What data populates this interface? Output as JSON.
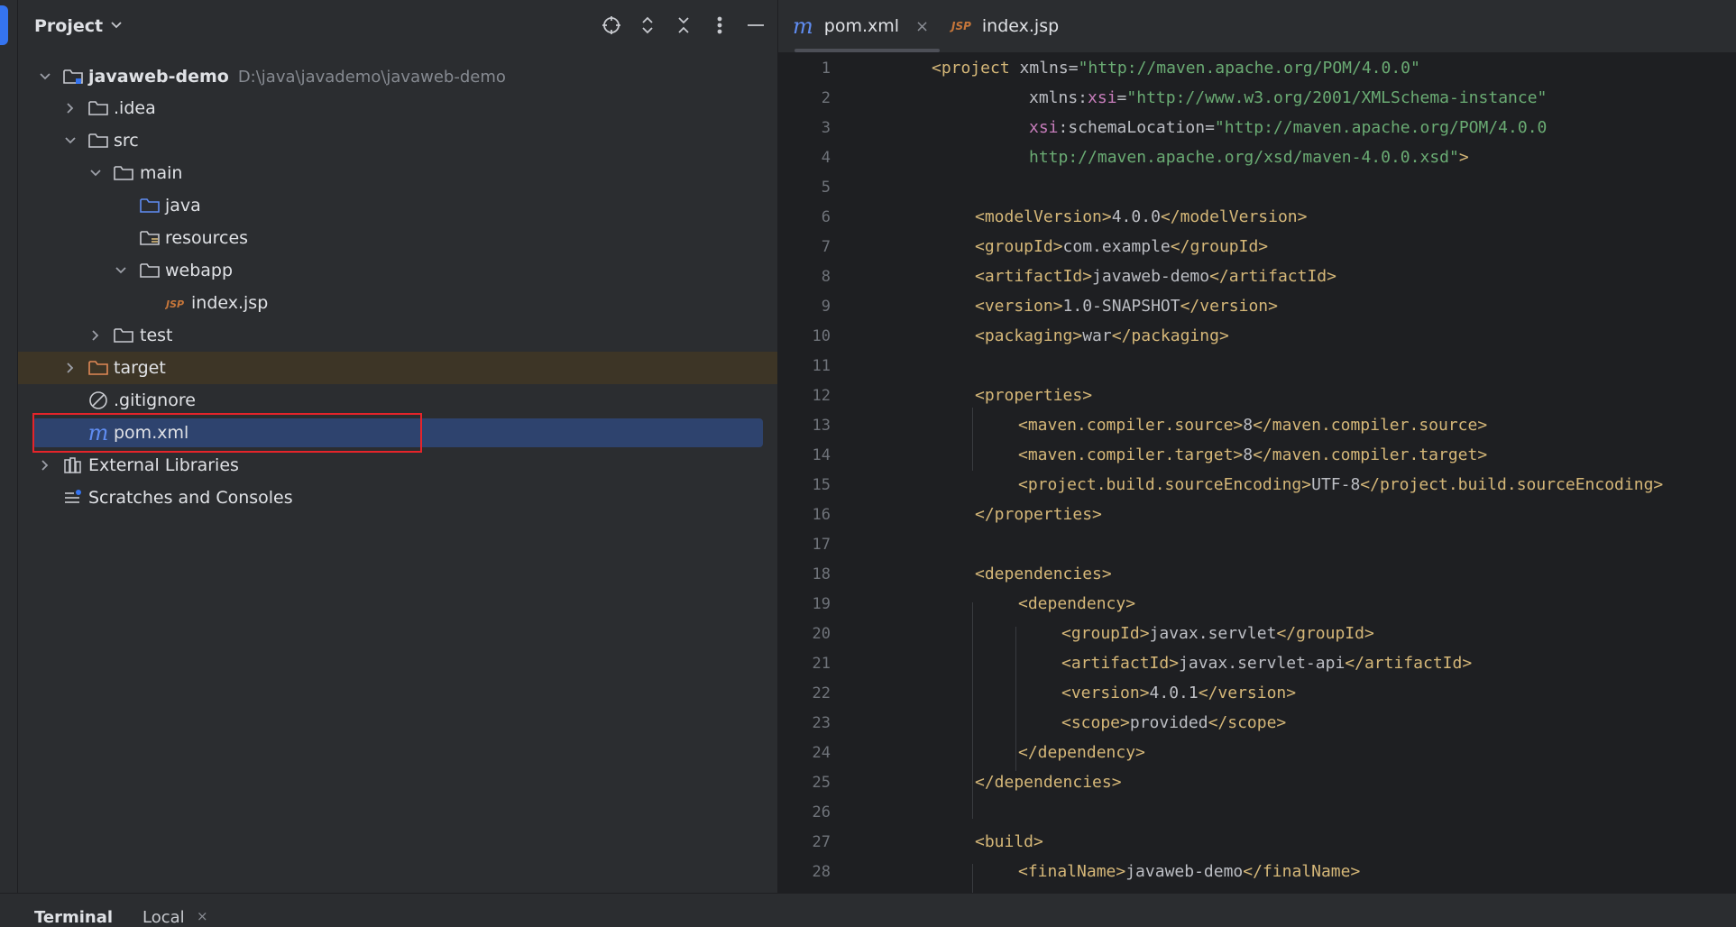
{
  "project_panel": {
    "title": "Project",
    "tree": [
      {
        "label": "javaweb-demo",
        "path": "D:\\java\\javademo\\javaweb-demo",
        "icon": "module-folder-icon",
        "state": "expanded"
      },
      {
        "label": ".idea",
        "icon": "folder-icon",
        "state": "collapsed"
      },
      {
        "label": "src",
        "icon": "folder-icon",
        "state": "expanded"
      },
      {
        "label": "main",
        "icon": "folder-icon",
        "state": "expanded"
      },
      {
        "label": "java",
        "icon": "source-folder-icon"
      },
      {
        "label": "resources",
        "icon": "resources-folder-icon"
      },
      {
        "label": "webapp",
        "icon": "folder-icon",
        "state": "expanded"
      },
      {
        "label": "index.jsp",
        "icon": "jsp-file-icon"
      },
      {
        "label": "test",
        "icon": "folder-icon",
        "state": "collapsed"
      },
      {
        "label": "target",
        "icon": "excluded-folder-icon",
        "state": "collapsed"
      },
      {
        "label": ".gitignore",
        "icon": "ignore-file-icon"
      },
      {
        "label": "pom.xml",
        "icon": "maven-icon",
        "selected": true
      },
      {
        "label": "External Libraries",
        "icon": "libraries-icon",
        "state": "collapsed"
      },
      {
        "label": "Scratches and Consoles",
        "icon": "scratches-icon"
      }
    ]
  },
  "editor": {
    "tabs": [
      {
        "label": "pom.xml",
        "icon": "maven-icon",
        "active": true,
        "close": "×"
      },
      {
        "label": "index.jsp",
        "icon": "jsp-file-icon",
        "active": false
      }
    ],
    "line_numbers": [
      "1",
      "2",
      "3",
      "4",
      "5",
      "6",
      "7",
      "8",
      "9",
      "10",
      "11",
      "12",
      "13",
      "14",
      "15",
      "16",
      "17",
      "18",
      "19",
      "20",
      "21",
      "22",
      "23",
      "24",
      "25",
      "26",
      "27",
      "28"
    ],
    "code_text": {
      "l1_tag": "<project",
      "l1_attr": " xmlns=",
      "l1_val": "\"http://maven.apache.org/POM/4.0.0\"",
      "l2_attr": "xmlns:",
      "l2_ns": "xsi",
      "l2_eq": "=",
      "l2_val": "\"http://www.w3.org/2001/XMLSchema-instance\"",
      "l3_ns": "xsi",
      "l3_attr": ":schemaLocation=",
      "l3_val": "\"http://maven.apache.org/POM/4.0.0",
      "l4_val": "http://maven.apache.org/xsd/maven-4.0.0.xsd\"",
      "l4_tag": ">",
      "l6_open": "<modelVersion>",
      "l6_text": "4.0.0",
      "l6_close": "</modelVersion>",
      "l7_open": "<groupId>",
      "l7_text": "com.example",
      "l7_close": "</groupId>",
      "l8_open": "<artifactId>",
      "l8_text": "javaweb-demo",
      "l8_close": "</artifactId>",
      "l9_open": "<version>",
      "l9_text": "1.0-SNAPSHOT",
      "l9_close": "</version>",
      "l10_open": "<packaging>",
      "l10_text": "war",
      "l10_close": "</packaging>",
      "l12": "<properties>",
      "l13_open": "<maven.compiler.source>",
      "l13_text": "8",
      "l13_close": "</maven.compiler.source>",
      "l14_open": "<maven.compiler.target>",
      "l14_text": "8",
      "l14_close": "</maven.compiler.target>",
      "l15_open": "<project.build.sourceEncoding>",
      "l15_text": "UTF-8",
      "l15_close": "</project.build.sourceEncoding>",
      "l16": "</properties>",
      "l18": "<dependencies>",
      "l19": "<dependency>",
      "l20_open": "<groupId>",
      "l20_text": "javax.servlet",
      "l20_close": "</groupId>",
      "l21_open": "<artifactId>",
      "l21_text": "javax.servlet-api",
      "l21_close": "</artifactId>",
      "l22_open": "<version>",
      "l22_text": "4.0.1",
      "l22_close": "</version>",
      "l23_open": "<scope>",
      "l23_text": "provided",
      "l23_close": "</scope>",
      "l24": "</dependency>",
      "l25": "</dependencies>",
      "l27": "<build>",
      "l28_open": "<finalName>",
      "l28_text": "javaweb-demo",
      "l28_close": "</finalName>"
    }
  },
  "bottom_bar": {
    "terminal_label": "Terminal",
    "local_tab": "Local",
    "local_close": "×"
  },
  "colors": {
    "accent": "#3574f0",
    "selection": "#2e436e",
    "highlight_border": "#e5242a",
    "excluded_row": "#3d3526"
  }
}
